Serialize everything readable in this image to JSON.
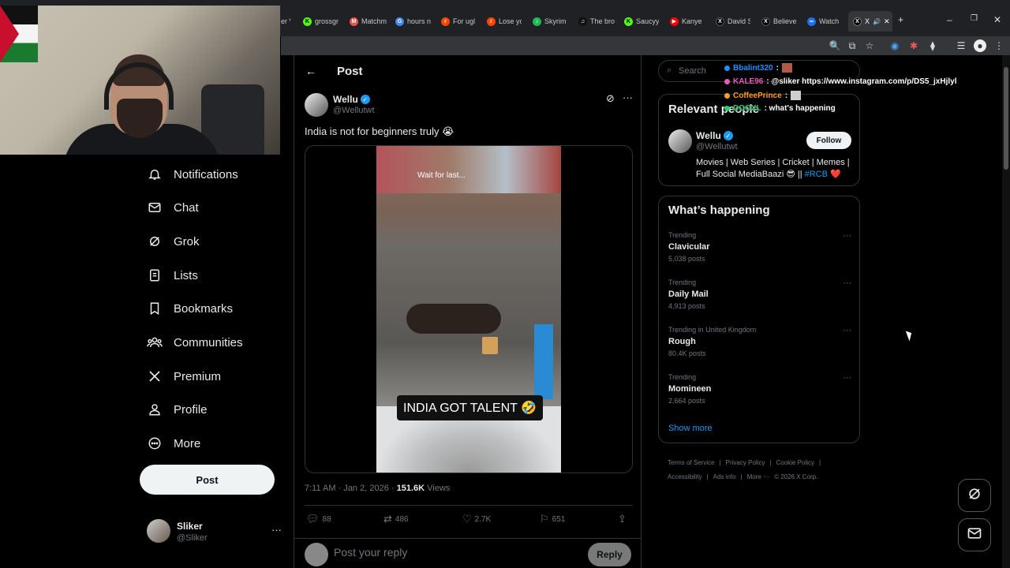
{
  "browser": {
    "tabs": [
      {
        "label": "er V",
        "favicon": "blank-icon",
        "color": "#202124"
      },
      {
        "label": "grossgr",
        "favicon": "kick-icon",
        "color": "#53fc18"
      },
      {
        "label": "Matchm",
        "favicon": "matchmaker-icon",
        "color": "#e8534a"
      },
      {
        "label": "hours n",
        "favicon": "google-icon",
        "color": "#4285f4"
      },
      {
        "label": "For ugl",
        "favicon": "reddit-icon",
        "color": "#ff4500"
      },
      {
        "label": "Lose yo",
        "favicon": "reddit-icon",
        "color": "#ff4500"
      },
      {
        "label": "Skyrim",
        "favicon": "spotify-icon",
        "color": "#1db954"
      },
      {
        "label": "The bro",
        "favicon": "tiktok-icon",
        "color": "#111111"
      },
      {
        "label": "Saucyy",
        "favicon": "kick-icon",
        "color": "#53fc18"
      },
      {
        "label": "Kanye",
        "favicon": "youtube-icon",
        "color": "#ff0000"
      },
      {
        "label": "David S",
        "favicon": "x-icon",
        "color": "#000000"
      },
      {
        "label": "Believe",
        "favicon": "x-icon",
        "color": "#000000"
      },
      {
        "label": "Watch",
        "favicon": "watch-icon",
        "color": "#1a73e8"
      },
      {
        "label": "X",
        "favicon": "x-icon",
        "color": "#000000"
      }
    ]
  },
  "chat_overlay": [
    {
      "user": "Bbalint320",
      "message": ":",
      "color": "#1e90ff"
    },
    {
      "user": "KALE96",
      "message": ": @sliker https://www.instagram.com/p/DS5_jxHjlyl",
      "color": "#e85bbd"
    },
    {
      "user": "CoffeePrince",
      "message": ":",
      "color": "#ff9f1c"
    },
    {
      "user": "DOOXL",
      "message": ": what's happening",
      "color": "#2ecc71"
    }
  ],
  "nav": {
    "items": [
      {
        "label": "Notifications",
        "icon": "bell-icon"
      },
      {
        "label": "Chat",
        "icon": "mail-icon"
      },
      {
        "label": "Grok",
        "icon": "grok-icon"
      },
      {
        "label": "Lists",
        "icon": "list-icon"
      },
      {
        "label": "Bookmarks",
        "icon": "bookmark-icon"
      },
      {
        "label": "Communities",
        "icon": "communities-icon"
      },
      {
        "label": "Premium",
        "icon": "x-logo-icon"
      },
      {
        "label": "Profile",
        "icon": "person-icon"
      },
      {
        "label": "More",
        "icon": "more-circle-icon"
      }
    ],
    "post_label": "Post"
  },
  "account": {
    "name": "Sliker",
    "handle": "@Sliker"
  },
  "main": {
    "title": "Post",
    "author": {
      "name": "Wellu",
      "handle": "@Wellutwt"
    },
    "text": "India is not for beginners truly 😭",
    "video_caption_top": "Wait for last...",
    "video_label": "INDIA GOT TALENT 🤣",
    "time": "7:11 AM · Jan 2, 2026 · ",
    "views_count": "151.6K",
    "views_label": " Views",
    "replies": "88",
    "reposts": "486",
    "likes": "2.7K",
    "bookmarks": "651",
    "reply_placeholder": "Post your reply",
    "reply_button": "Reply"
  },
  "right": {
    "search_placeholder": "Search",
    "relevant_title": "Relevant people",
    "relevant": {
      "name": "Wellu",
      "handle": "@Wellutwt",
      "follow_label": "Follow",
      "bio": "Movies | Web Series | Cricket | Memes | Full Social MediaBaazi 😎 || ",
      "bio_tag": "#RCB",
      "bio_end": " ❤️"
    },
    "happening_title": "What’s happening",
    "trends": [
      {
        "context": "Trending",
        "title": "Clavicular",
        "count": "5,038 posts"
      },
      {
        "context": "Trending",
        "title": "Daily Mail",
        "count": "4,913 posts"
      },
      {
        "context": "Trending in United Kingdom",
        "title": "Rough",
        "count": "80.4K posts"
      },
      {
        "context": "Trending",
        "title": "Momineen",
        "count": "2,664 posts"
      }
    ],
    "show_more": "Show more",
    "footer": [
      "Terms of Service",
      "|",
      "Privacy Policy",
      "|",
      "Cookie Policy",
      "|",
      "Accessibility",
      "|",
      "Ads info",
      "|",
      "More ···",
      "© 2026 X Corp."
    ]
  }
}
